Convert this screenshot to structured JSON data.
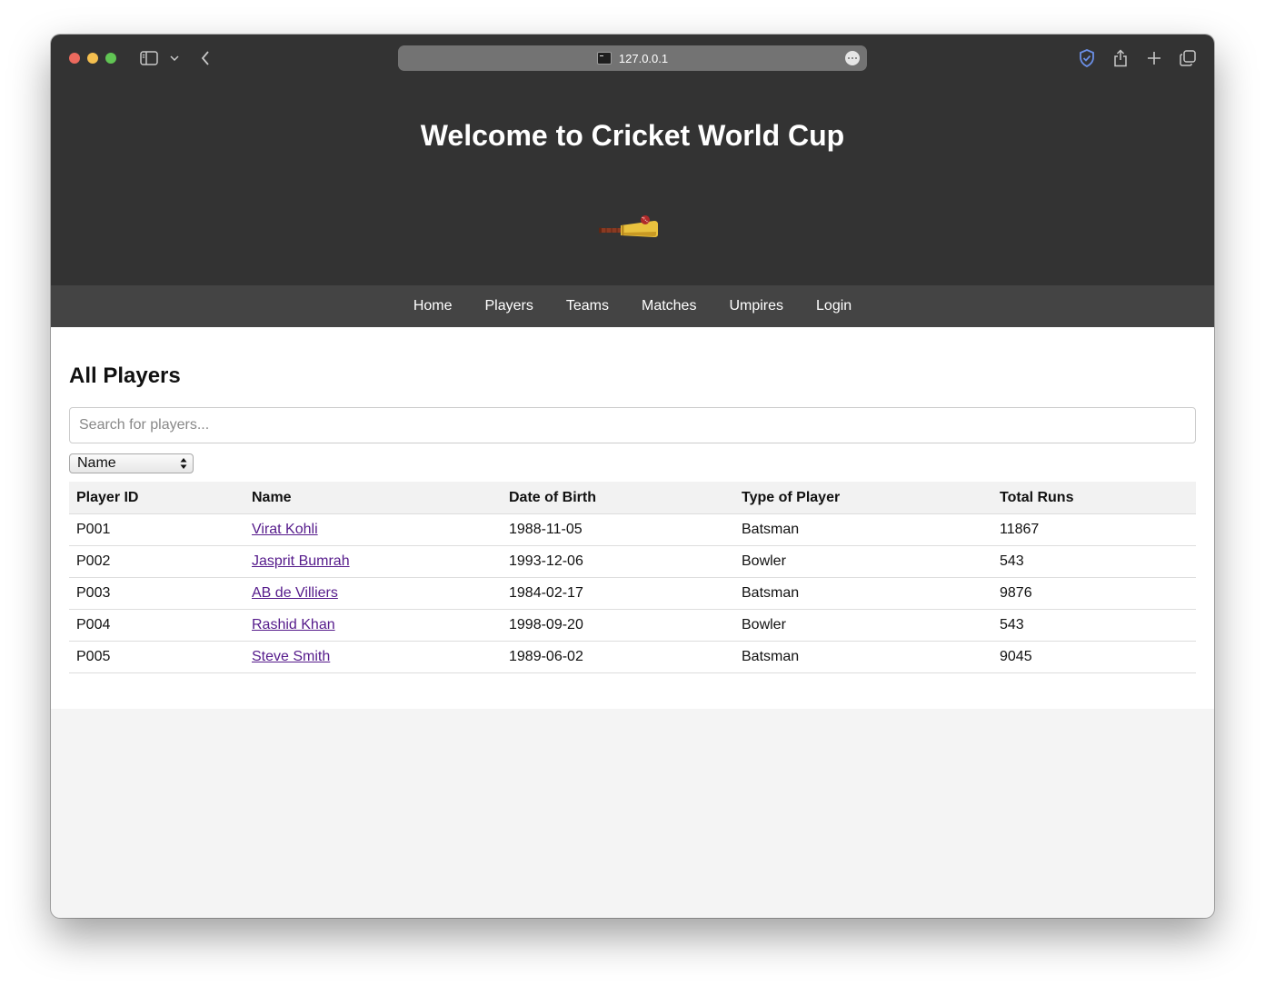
{
  "browser": {
    "url": "127.0.0.1",
    "icons": [
      "sidebar-icon",
      "chevron-down-icon",
      "back-icon",
      "more-icon",
      "shield-icon",
      "share-icon",
      "plus-icon",
      "tabs-icon"
    ]
  },
  "header": {
    "title": "Welcome to Cricket World Cup",
    "logo_icon": "cricket-bat-ball-icon"
  },
  "nav": {
    "items": [
      {
        "label": "Home"
      },
      {
        "label": "Players"
      },
      {
        "label": "Teams"
      },
      {
        "label": "Matches"
      },
      {
        "label": "Umpires"
      },
      {
        "label": "Login"
      }
    ]
  },
  "main": {
    "heading": "All Players",
    "search_placeholder": "Search for players...",
    "search_value": "",
    "sort_selected": "Name"
  },
  "table": {
    "columns": [
      "Player ID",
      "Name",
      "Date of Birth",
      "Type of Player",
      "Total Runs"
    ],
    "rows": [
      {
        "id": "P001",
        "name": "Virat Kohli",
        "dob": "1988-11-05",
        "type": "Batsman",
        "runs": "11867"
      },
      {
        "id": "P002",
        "name": "Jasprit Bumrah",
        "dob": "1993-12-06",
        "type": "Bowler",
        "runs": "543"
      },
      {
        "id": "P003",
        "name": "AB de Villiers",
        "dob": "1984-02-17",
        "type": "Batsman",
        "runs": "9876"
      },
      {
        "id": "P004",
        "name": "Rashid Khan",
        "dob": "1998-09-20",
        "type": "Bowler",
        "runs": "543"
      },
      {
        "id": "P005",
        "name": "Steve Smith",
        "dob": "1989-06-02",
        "type": "Batsman",
        "runs": "9045"
      }
    ]
  },
  "colors": {
    "header_bg": "#333333",
    "nav_bg": "#444444",
    "link": "#551a8b",
    "table_header_bg": "#f2f2f2"
  }
}
